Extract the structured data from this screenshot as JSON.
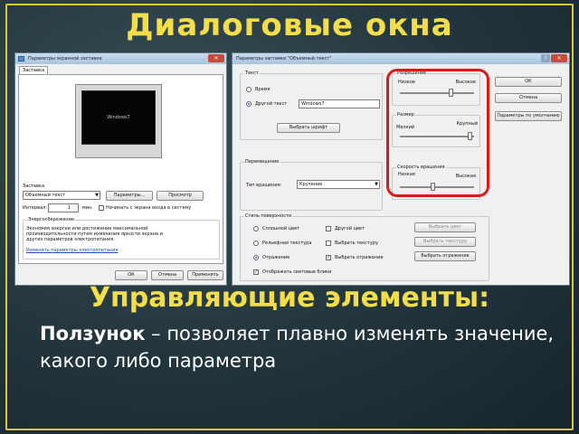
{
  "slide": {
    "title": "Диалоговые окна",
    "subtitle": "Управляющие элементы:",
    "term": "Ползунок",
    "definition": " – позволяет плавно изменять значение, какого либо параметра"
  },
  "left_dialog": {
    "title": "Параметры экранной заставки",
    "tab": "Заставка",
    "preview_text": "Windows7",
    "group_screensaver": "Заставка",
    "screensaver_value": "Объемный текст",
    "btn_params": "Параметры...",
    "btn_preview": "Просмотр",
    "interval_label": "Интервал:",
    "interval_value": "1",
    "interval_unit": "мин.",
    "logon_check_label": "Начинать с экрана входа в систему",
    "group_power": "Энергосбережение",
    "power_text": "Экономия энергии или достижение максимальной производительности путем изменения яркости экрана и других параметров электропитания.",
    "power_link": "Изменить параметры электропитания",
    "btn_ok": "ОК",
    "btn_cancel": "Отмена",
    "btn_apply": "Применить"
  },
  "right_dialog": {
    "title": "Параметры заставки \"Объемный текст\"",
    "group_text": "Текст",
    "radio_time": "Время",
    "radio_other": "Другой текст",
    "other_text_value": "Windows7",
    "btn_font": "Выбрать шрифт",
    "group_motion": "Перемещение",
    "rotation_label": "Тип вращения:",
    "rotation_value": "Кручение",
    "group_surface": "Стиль поверхности",
    "surface_solid": "Сплошной цвет",
    "surface_texture": "Рельефная текстура",
    "surface_reflect": "Отражение",
    "surface_custom_color": "Другой цвет",
    "surface_custom_texture": "Выбрать текстуру",
    "surface_custom_reflect": "Выбрать отражение",
    "btn_pick_color": "Выбрать цвет",
    "btn_pick_texture": "Выбрать текстуру",
    "btn_pick_reflect": "Выбрать отражение",
    "highlights_check": "Отображать световые блики",
    "btn_ok": "ОК",
    "btn_cancel": "Отмена",
    "btn_defaults": "Параметры по умолчанию",
    "slider_resolution": {
      "title": "Разрешение",
      "min_label": "Низкое",
      "max_label": "Высокое",
      "value_fraction": 0.7
    },
    "slider_size": {
      "title": "Размер",
      "min_label": "Мелкий",
      "max_label": "Крупный",
      "value_fraction": 0.95
    },
    "slider_speed": {
      "title": "Скорость вращения",
      "min_label": "Низкая",
      "max_label": "Высокая",
      "value_fraction": 0.45
    }
  },
  "colors": {
    "title_yellow": "#f2de4a",
    "highlight_red": "#e01818",
    "frame_yellow": "#d8c83a"
  }
}
